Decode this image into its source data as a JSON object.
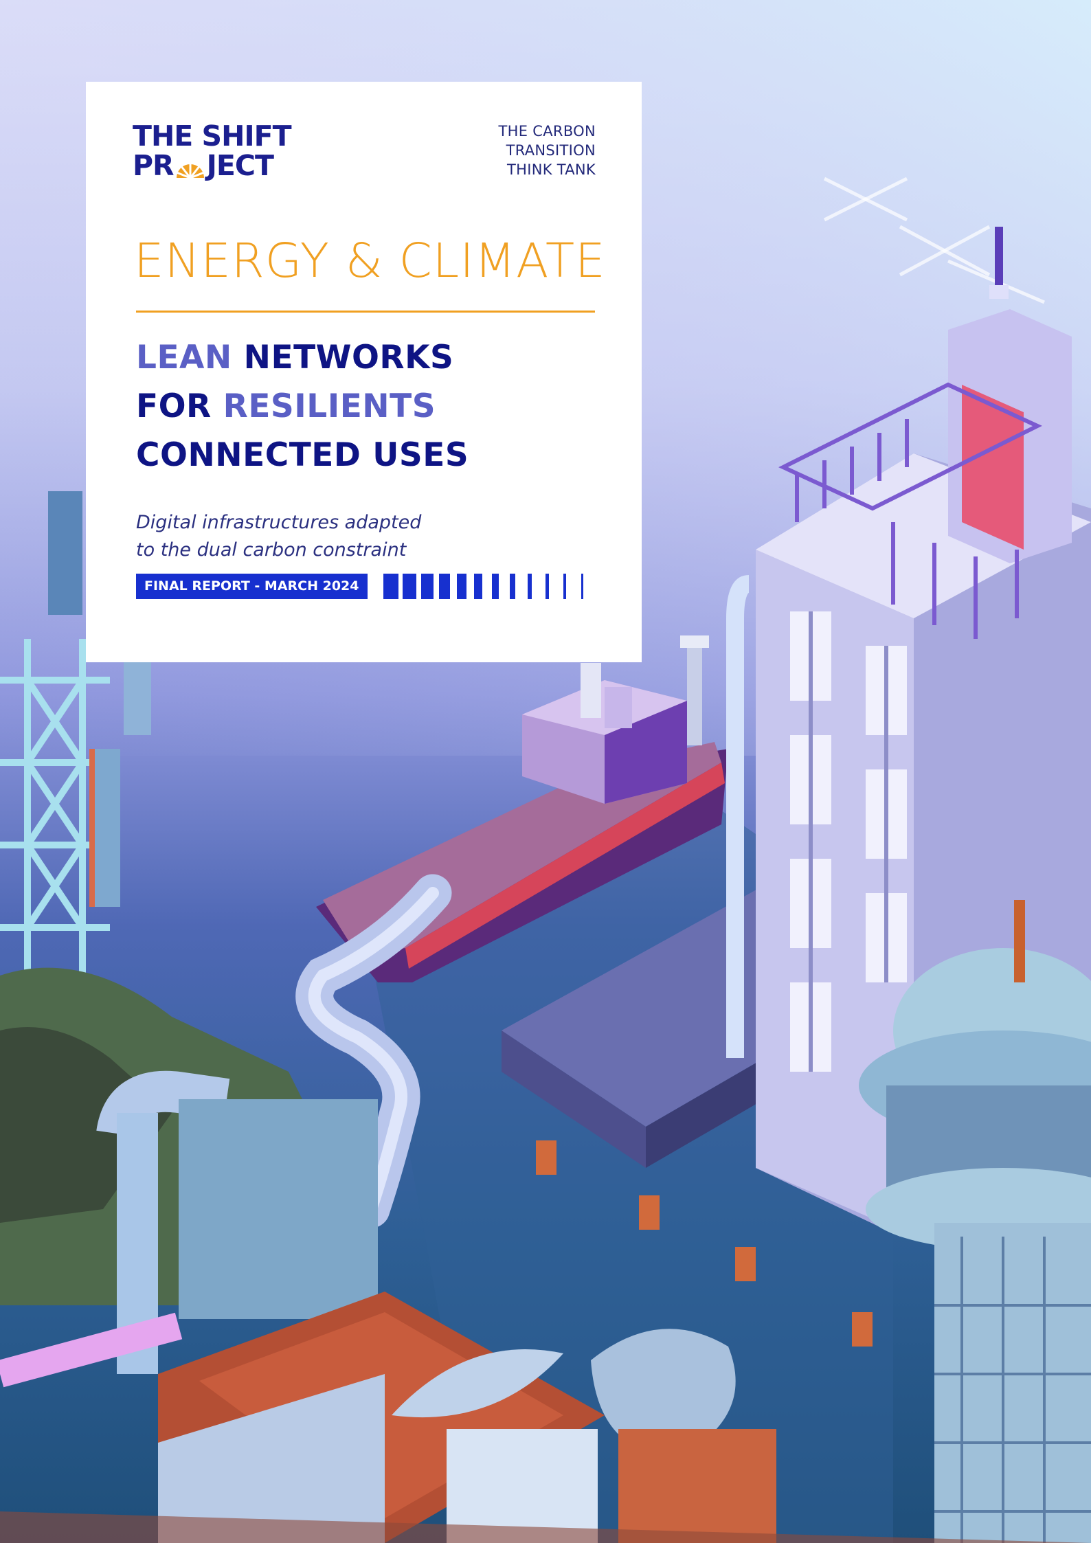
{
  "logo": {
    "line1": "THE SHIFT",
    "line2_a": "PR",
    "line2_b": "JECT"
  },
  "tagline": [
    "THE CARBON",
    "TRANSITION",
    "THINK TANK"
  ],
  "series": "ENERGY & CLIMATE",
  "title": {
    "line1_hl": "LEAN",
    "line1_rest": " NETWORKS",
    "line2_a": "FOR ",
    "line2_hl": "RESILIENTS",
    "line3": "CONNECTED USES"
  },
  "subtitle": [
    "Digital infrastructures adapted",
    "to the dual carbon constraint"
  ],
  "badge": "FINAL REPORT - MARCH 2024",
  "colors": {
    "accent": "#f0a022",
    "navy": "#0e1484",
    "highlight": "#5a5fc5",
    "badge_blue": "#1730cf"
  },
  "illustration": "isometric pixel-art harbour scene with tanker ship, offshore platform, tower building, telecom mast, pipes and satellite dishes"
}
